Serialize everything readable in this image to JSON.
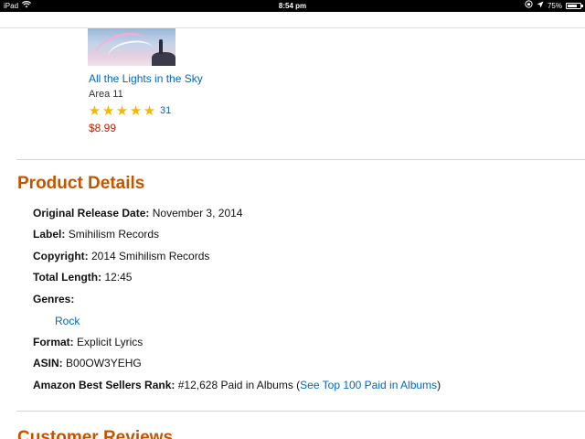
{
  "status_bar": {
    "device": "iPad",
    "time": "8:54 pm",
    "battery_percent": "75%",
    "battery_level": 0.75,
    "icons": [
      "wifi-icon",
      "orientation-lock-icon",
      "location-arrow-icon",
      "battery-icon"
    ]
  },
  "album": {
    "title": "All the Lights in the Sky",
    "artist": "Area 11",
    "rating_stars": 5,
    "review_count": "31",
    "price": "$8.99"
  },
  "product_details": {
    "heading": "Product Details",
    "release_date": {
      "label": "Original Release Date:",
      "value": "November 3, 2014"
    },
    "record_label": {
      "label": "Label:",
      "value": "Smihilism Records"
    },
    "copyright": {
      "label": "Copyright:",
      "value": "2014 Smihilism Records"
    },
    "total_length": {
      "label": "Total Length:",
      "value": "12:45"
    },
    "genres": {
      "label": "Genres:",
      "items": [
        "Rock"
      ]
    },
    "format": {
      "label": "Format:",
      "value": "Explicit Lyrics"
    },
    "asin": {
      "label": "ASIN:",
      "value": "B00OW3YEHG"
    },
    "rank": {
      "label": "Amazon Best Sellers Rank:",
      "value": "#12,628 Paid in Albums",
      "open_paren": "(",
      "link": "See Top 100 Paid in Albums",
      "close_paren": ")"
    }
  },
  "next_section": {
    "heading": "Customer Reviews"
  },
  "colors": {
    "heading": "#c45500",
    "link": "#0066c0",
    "price": "#b12704",
    "star": "#f5b800"
  }
}
